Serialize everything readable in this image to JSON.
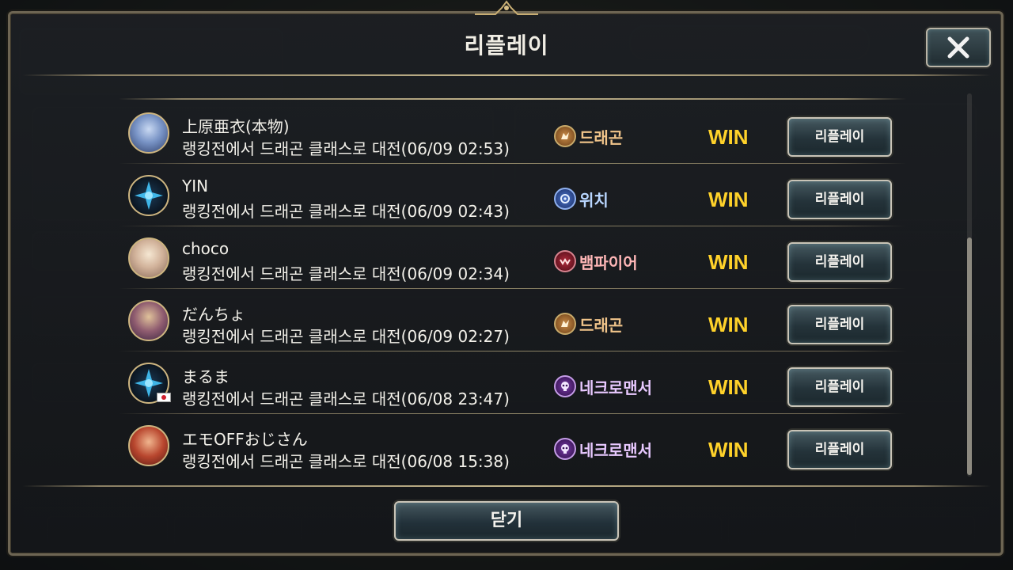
{
  "modal": {
    "title": "리플레이",
    "close_icon": "close-x-icon",
    "footer_button_label": "닫기"
  },
  "replays": [
    {
      "player": "上原亜衣(本物)",
      "description": "랭킹전에서 드래곤 클래스로 대전(06/09 02:53)",
      "opponent_class": "드래곤",
      "class_icon": "dragon-class-icon",
      "class_color": "#f0c48a",
      "result": "WIN",
      "button_label": "리플레이",
      "flag": false
    },
    {
      "player": "YIN",
      "description": "랭킹전에서 드래곤 클래스로 대전(06/09 02:43)",
      "opponent_class": "위치",
      "class_icon": "witch-class-icon",
      "class_color": "#b9d6ff",
      "result": "WIN",
      "button_label": "리플레이",
      "flag": false
    },
    {
      "player": "choco",
      "description": "랭킹전에서 드래곤 클래스로 대전(06/09 02:34)",
      "opponent_class": "뱀파이어",
      "class_icon": "vampire-class-icon",
      "class_color": "#ffb7b7",
      "result": "WIN",
      "button_label": "리플레이",
      "flag": false
    },
    {
      "player": "だんちょ",
      "description": "랭킹전에서 드래곤 클래스로 대전(06/09 02:27)",
      "opponent_class": "드래곤",
      "class_icon": "dragon-class-icon",
      "class_color": "#f0c48a",
      "result": "WIN",
      "button_label": "리플레이",
      "flag": false
    },
    {
      "player": "まるま",
      "description": "랭킹전에서 드래곤 클래스로 대전(06/08 23:47)",
      "opponent_class": "네크로맨서",
      "class_icon": "necromancer-class-icon",
      "class_color": "#e8c9ff",
      "result": "WIN",
      "button_label": "리플레이",
      "flag": true
    },
    {
      "player": "エモOFFおじさん",
      "description": "랭킹전에서 드래곤 클래스로 대전(06/08 15:38)",
      "opponent_class": "네크로맨서",
      "class_icon": "necromancer-class-icon",
      "class_color": "#e8c9ff",
      "result": "WIN",
      "button_label": "리플레이",
      "flag": false
    }
  ],
  "colors": {
    "win": "#ffd22a",
    "frame_gold": "#c2b48b"
  }
}
